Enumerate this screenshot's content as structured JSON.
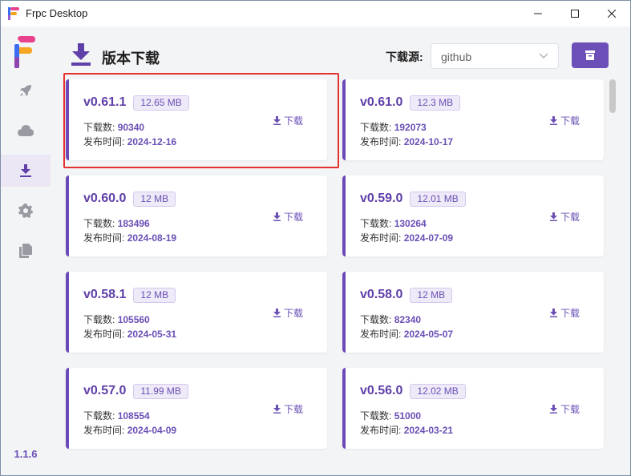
{
  "window": {
    "title": "Frpc Desktop"
  },
  "sidebar": {
    "items": [
      {
        "name": "rocket",
        "active": false
      },
      {
        "name": "cloud",
        "active": false
      },
      {
        "name": "download",
        "active": true
      },
      {
        "name": "gear",
        "active": false
      },
      {
        "name": "document",
        "active": false
      }
    ],
    "version": "1.1.6"
  },
  "header": {
    "title": "版本下载",
    "source_label": "下载源:",
    "source_value": "github"
  },
  "labels": {
    "download_count": "下载数:",
    "publish_time": "发布时间:",
    "download_button": "下载"
  },
  "releases": [
    {
      "version": "v0.61.1",
      "size": "12.65 MB",
      "downloads": "90340",
      "date": "2024-12-16",
      "selected": true
    },
    {
      "version": "v0.61.0",
      "size": "12.3 MB",
      "downloads": "192073",
      "date": "2024-10-17"
    },
    {
      "version": "v0.60.0",
      "size": "12 MB",
      "downloads": "183496",
      "date": "2024-08-19"
    },
    {
      "version": "v0.59.0",
      "size": "12.01 MB",
      "downloads": "130264",
      "date": "2024-07-09"
    },
    {
      "version": "v0.58.1",
      "size": "12 MB",
      "downloads": "105560",
      "date": "2024-05-31"
    },
    {
      "version": "v0.58.0",
      "size": "12 MB",
      "downloads": "82340",
      "date": "2024-05-07"
    },
    {
      "version": "v0.57.0",
      "size": "11.99 MB",
      "downloads": "108554",
      "date": "2024-04-09"
    },
    {
      "version": "v0.56.0",
      "size": "12.02 MB",
      "downloads": "51000",
      "date": "2024-03-21"
    }
  ],
  "colors": {
    "accent": "#6b49b8",
    "highlight": "#e53030"
  }
}
